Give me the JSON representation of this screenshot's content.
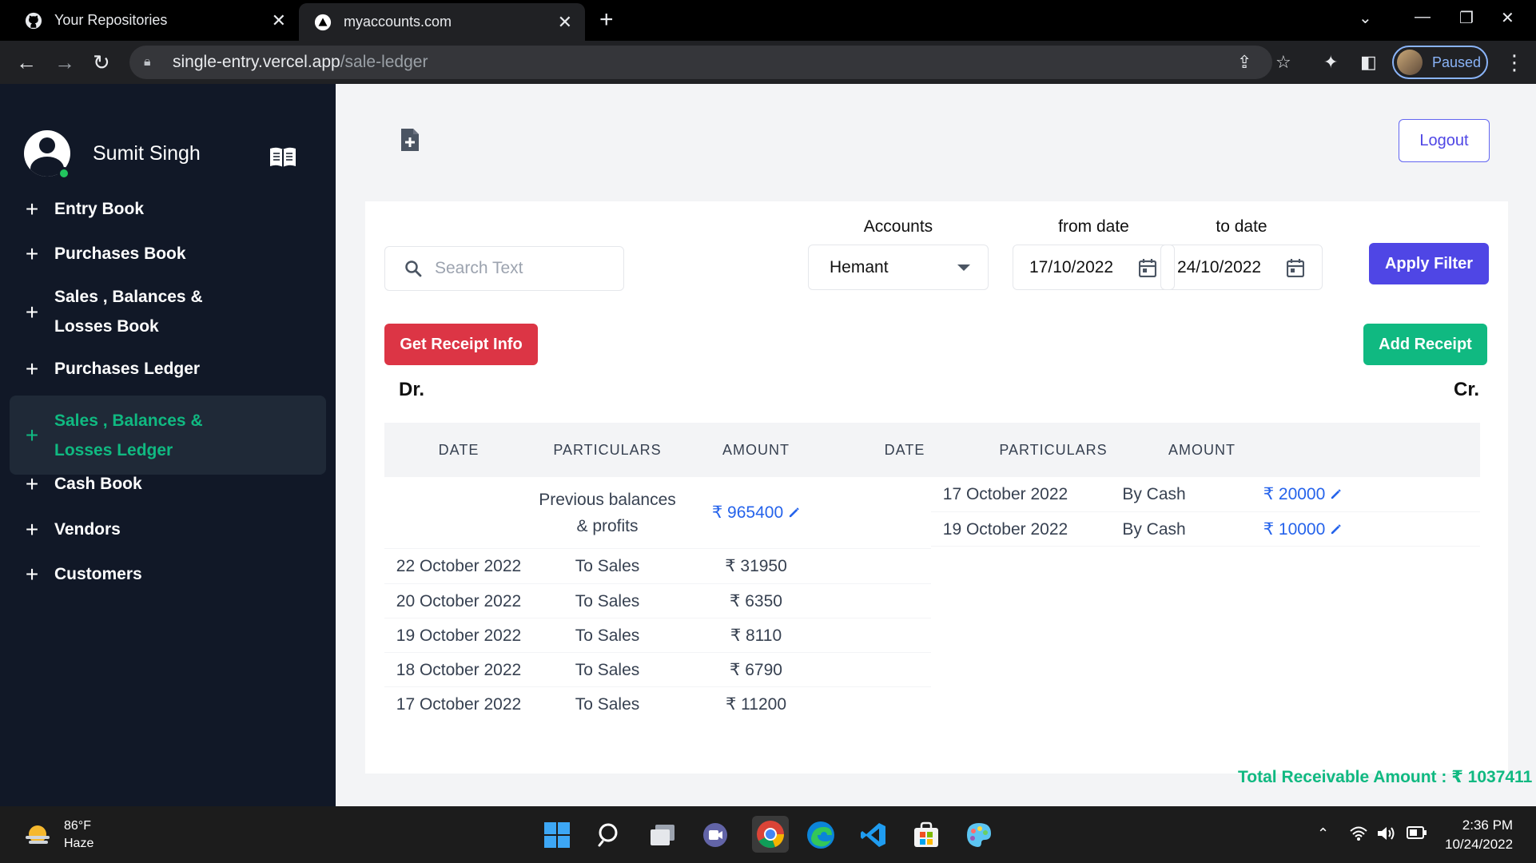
{
  "browser": {
    "tabs": [
      {
        "title": "Your Repositories",
        "icon": "github-icon"
      },
      {
        "title": "myaccounts.com",
        "icon": "vercel-icon"
      }
    ],
    "url_host": "single-entry.vercel.app",
    "url_path": "/sale-ledger",
    "profile_status": "Paused"
  },
  "sidebar": {
    "user_name": "Sumit Singh",
    "items": [
      {
        "label": "Entry Book"
      },
      {
        "label": "Purchases Book"
      },
      {
        "label": "Sales , Balances & Losses Book"
      },
      {
        "label": "Purchases Ledger"
      },
      {
        "label": "Sales , Balances & Losses Ledger",
        "active": true
      },
      {
        "label": "Cash Book"
      },
      {
        "label": "Vendors"
      },
      {
        "label": "Customers"
      }
    ]
  },
  "header": {
    "logout_label": "Logout"
  },
  "filters": {
    "search_placeholder": "Search Text",
    "accounts_label": "Accounts",
    "account_value": "Hemant",
    "from_label": "from date",
    "from_value": "17/10/2022",
    "to_label": "to date",
    "to_value": "24/10/2022",
    "apply_label": "Apply Filter"
  },
  "actions": {
    "receipt_info_label": "Get Receipt Info",
    "add_receipt_label": "Add Receipt"
  },
  "ledger": {
    "dr_label": "Dr.",
    "cr_label": "Cr.",
    "columns": [
      "DATE",
      "PARTICULARS",
      "AMOUNT",
      "DATE",
      "PARTICULARS",
      "AMOUNT"
    ],
    "debit_rows": [
      {
        "date": "",
        "particulars_line1": "Previous balances",
        "particulars_line2": "& profits",
        "amount": "₹ 965400",
        "editable": true
      },
      {
        "date": "22 October 2022",
        "particulars": "To Sales",
        "amount": "₹ 31950"
      },
      {
        "date": "20 October 2022",
        "particulars": "To Sales",
        "amount": "₹ 6350"
      },
      {
        "date": "19 October 2022",
        "particulars": "To Sales",
        "amount": "₹ 8110"
      },
      {
        "date": "18 October 2022",
        "particulars": "To Sales",
        "amount": "₹ 6790"
      },
      {
        "date": "17 October 2022",
        "particulars": "To Sales",
        "amount": "₹ 11200"
      }
    ],
    "credit_rows": [
      {
        "date": "17 October 2022",
        "particulars": "By Cash",
        "amount": "₹ 20000",
        "editable": true
      },
      {
        "date": "19 October 2022",
        "particulars": "By Cash",
        "amount": "₹ 10000",
        "editable": true
      }
    ],
    "total_label": "Total Receivable Amount : ₹ 1037411"
  },
  "taskbar": {
    "weather_temp": "86°F",
    "weather_desc": "Haze",
    "time": "2:36 PM",
    "date": "10/24/2022"
  },
  "colors": {
    "sidebar_bg": "#111827",
    "active_green": "#10b981",
    "primary": "#4f46e5",
    "danger": "#dc3545",
    "link_blue": "#2563eb"
  }
}
